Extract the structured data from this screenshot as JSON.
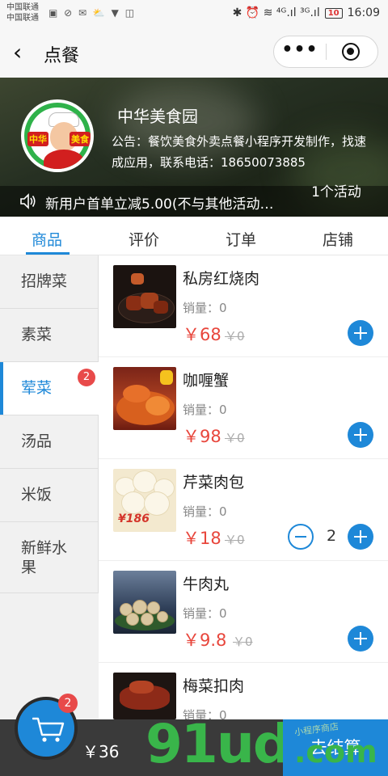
{
  "status_bar": {
    "carrier_1": "中国联通",
    "carrier_2": "中国联通",
    "left_icons": "▣ ⊘ ✉ ⛅ ▼ ◫",
    "right_icons": "✱ ⏰ ≋ ⁴ᴳ.ıl ³ᴳ.ıl",
    "battery": "10",
    "time": "16:09"
  },
  "nav": {
    "back_icon": "‹",
    "title": "点餐",
    "more_icon": "•••"
  },
  "shop": {
    "name": "中华美食园",
    "logo_text_left": "中华",
    "logo_text_right": "美食",
    "notice": "公告：餐饮美食外卖点餐小程序开发制作，找速成应用，联系电话：18650073885",
    "promo": "新用户首单立减5.00(不与其他活动…",
    "activity_count": "1个活动"
  },
  "tabs": [
    {
      "label": "商品",
      "active": true
    },
    {
      "label": "评价",
      "active": false
    },
    {
      "label": "订单",
      "active": false
    },
    {
      "label": "店铺",
      "active": false
    }
  ],
  "categories": [
    {
      "label": "招牌菜",
      "badge": ""
    },
    {
      "label": "素菜",
      "badge": ""
    },
    {
      "label": "荤菜",
      "badge": "2",
      "active": true
    },
    {
      "label": "汤品",
      "badge": ""
    },
    {
      "label": "米饭",
      "badge": ""
    },
    {
      "label": "新鲜水果",
      "badge": ""
    }
  ],
  "products": [
    {
      "name": "私房红烧肉",
      "sales": "销量：0",
      "price": "￥68",
      "old_price": "￥0",
      "qty": ""
    },
    {
      "name": "咖喱蟹",
      "sales": "销量：0",
      "price": "￥98",
      "old_price": "￥0",
      "qty": ""
    },
    {
      "name": "芹菜肉包",
      "sales": "销量：0",
      "price": "￥18",
      "old_price": "￥0",
      "qty": "2",
      "img_tag": "¥186"
    },
    {
      "name": "牛肉丸",
      "sales": "销量：0",
      "price": "￥9.8",
      "old_price": "￥0",
      "qty": ""
    },
    {
      "name": "梅菜扣肉",
      "sales": "销量：0",
      "price": "",
      "old_price": "",
      "qty": ""
    }
  ],
  "cart": {
    "badge": "2",
    "total": "￥36",
    "checkout_label": "去结算"
  },
  "watermark": {
    "main": "91ud",
    "suffix": ".com",
    "small": "小程序商店"
  },
  "colors": {
    "accent": "#1e88d8",
    "price": "#e8463c",
    "badge": "#e84a4a",
    "bottom_bar": "#3a3a3a"
  }
}
